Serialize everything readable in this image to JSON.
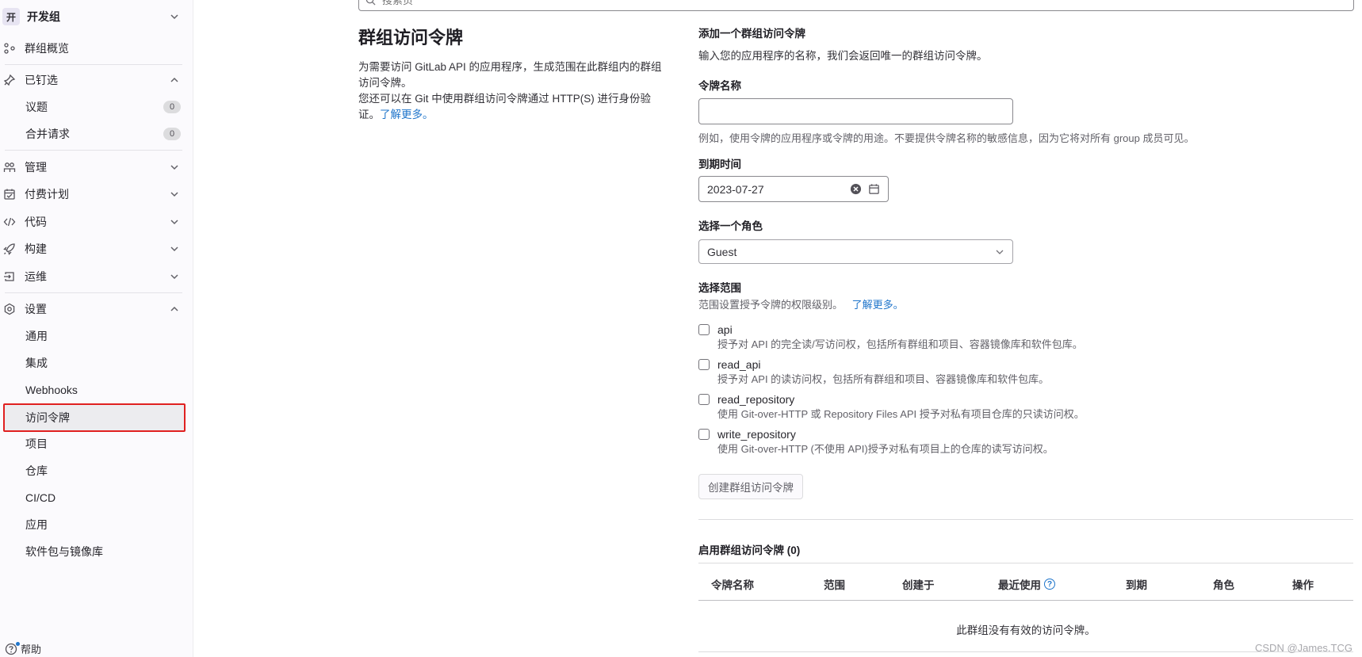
{
  "sidebar": {
    "group_avatar": "开",
    "group_name": "开发组",
    "overview": "群组概览",
    "pinned": "已钉选",
    "pinned_items": [
      {
        "label": "议题",
        "count": "0"
      },
      {
        "label": "合并请求",
        "count": "0"
      }
    ],
    "manage": "管理",
    "plan": "付费计划",
    "code": "代码",
    "build": "构建",
    "operate": "运维",
    "settings": "设置",
    "settings_items": [
      "通用",
      "集成",
      "Webhooks",
      "访问令牌",
      "项目",
      "仓库",
      "CI/CD",
      "应用",
      "软件包与镜像库"
    ],
    "help": "帮助"
  },
  "search": {
    "placeholder": "搜索页"
  },
  "intro": {
    "title": "群组访问令牌",
    "line1": "为需要访问 GitLab API 的应用程序，生成范围在此群组内的群组访问令牌。",
    "line2": "您还可以在 Git 中使用群组访问令牌通过 HTTP(S) 进行身份验证。",
    "learn_more": "了解更多。"
  },
  "form": {
    "heading": "添加一个群组访问令牌",
    "subheading": "输入您的应用程序的名称，我们会返回唯一的群组访问令牌。",
    "name_label": "令牌名称",
    "name_value": "",
    "name_help": "例如，使用令牌的应用程序或令牌的用途。不要提供令牌名称的敏感信息，因为它将对所有 group 成员可见。",
    "expiry_label": "到期时间",
    "expiry_value": "2023-07-27",
    "role_label": "选择一个角色",
    "role_value": "Guest",
    "scope_label": "选择范围",
    "scope_help": "范围设置授予令牌的权限级别。",
    "scope_learn_more": "了解更多。",
    "scopes": [
      {
        "name": "api",
        "desc": "授予对 API 的完全读/写访问权，包括所有群组和项目、容器镜像库和软件包库。"
      },
      {
        "name": "read_api",
        "desc": "授予对 API 的读访问权，包括所有群组和项目、容器镜像库和软件包库。"
      },
      {
        "name": "read_repository",
        "desc": "使用 Git-over-HTTP 或 Repository Files API 授予对私有项目仓库的只读访问权。"
      },
      {
        "name": "write_repository",
        "desc": "使用 Git-over-HTTP (不使用 API)授予对私有项目上的仓库的读写访问权。"
      }
    ],
    "submit": "创建群组访问令牌"
  },
  "active_tokens": {
    "title": "启用群组访问令牌 (0)",
    "columns": [
      "令牌名称",
      "范围",
      "创建于",
      "最近使用",
      "到期",
      "角色",
      "操作"
    ],
    "empty": "此群组没有有效的访问令牌。"
  },
  "watermark": "CSDN @James.TCG"
}
